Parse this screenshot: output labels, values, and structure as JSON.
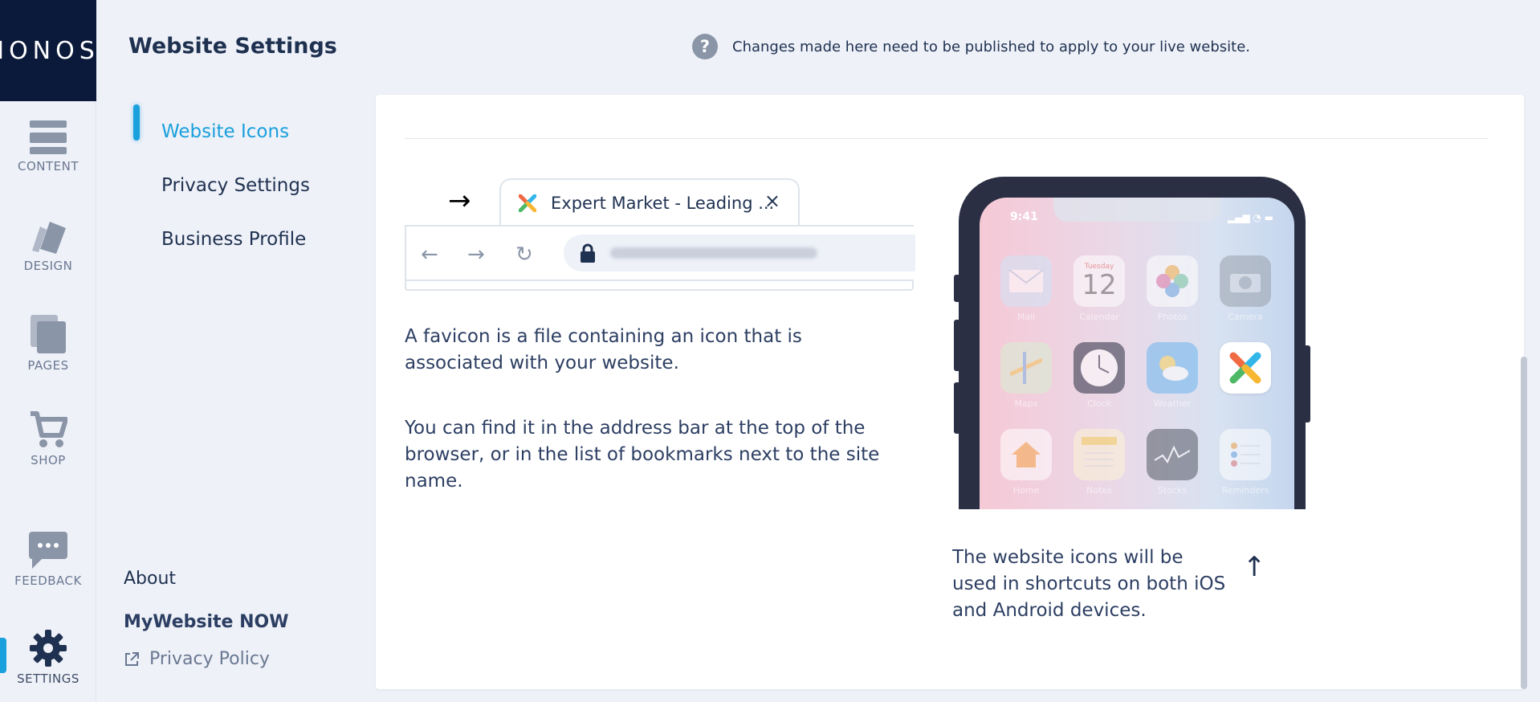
{
  "brand": {
    "logo": "IONOS"
  },
  "rail": {
    "items": [
      {
        "label": "CONTENT"
      },
      {
        "label": "DESIGN"
      },
      {
        "label": "PAGES"
      },
      {
        "label": "SHOP"
      },
      {
        "label": "FEEDBACK"
      },
      {
        "label": "SETTINGS"
      }
    ]
  },
  "header": {
    "title": "Website Settings",
    "notice": "Changes made here need to be published to apply to your live website.",
    "help_glyph": "?"
  },
  "settings_nav": {
    "items": [
      {
        "label": "Website Icons"
      },
      {
        "label": "Privacy Settings"
      },
      {
        "label": "Business Profile"
      }
    ]
  },
  "footer": {
    "about": "About",
    "product": "MyWebsite NOW",
    "privacy": "Privacy Policy"
  },
  "favicon_section": {
    "browser_tab_title": "Expert Market - Leading ...",
    "tab_close": "×",
    "paragraph_1": "A favicon is a file containing an icon that is associated with your website.",
    "paragraph_2": "You can find it in the address bar at the top of the browser, or in the list of bookmarks next to the site name."
  },
  "ios_section": {
    "status_time": "9:41",
    "apps": [
      {
        "label": "Mail"
      },
      {
        "label": "Calendar"
      },
      {
        "label": "Photos"
      },
      {
        "label": "Camera"
      },
      {
        "label": "Maps"
      },
      {
        "label": "Clock"
      },
      {
        "label": "Weather"
      },
      {
        "label": ""
      },
      {
        "label": "Home"
      },
      {
        "label": "Notes"
      },
      {
        "label": "Stocks"
      },
      {
        "label": "Reminders"
      }
    ],
    "calendar_day": "Tuesday",
    "calendar_date": "12",
    "description": "The website icons will be used in shortcuts on both iOS and Android devices."
  },
  "colors": {
    "accent": "#1aa0dc",
    "navy": "#0b1a3a",
    "text": "#1f3150",
    "muted": "#6a7891"
  }
}
